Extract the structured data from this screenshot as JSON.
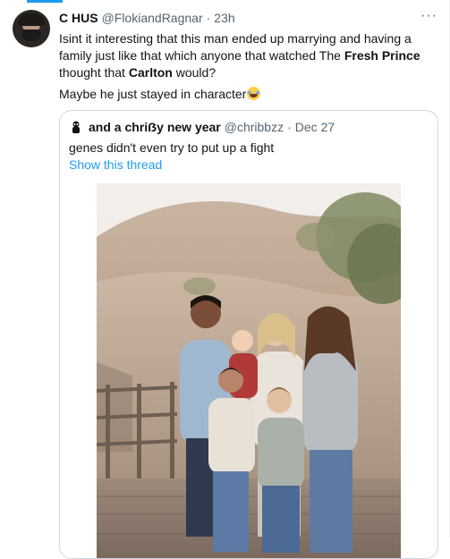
{
  "tweet": {
    "author_name": "C HUS",
    "author_handle": "@FlokiandRagnar",
    "separator": "·",
    "time": "23h",
    "more_icon": "ellipsis-icon",
    "text_part1": "Isint it interesting that this man ended up marrying and having a family just like that which anyone that watched The ",
    "text_bold1": "Fresh Prince",
    "text_part2": " thought that ",
    "text_bold2": "Carlton",
    "text_part3": " would?",
    "text_line2": "Maybe he just stayed in character",
    "emoji": "face-with-tears-of-joy"
  },
  "quoted_tweet": {
    "author_name": "and a chriẞy new year",
    "author_handle": "@chribbzz",
    "separator": "·",
    "date": "Dec 27",
    "text": "genes didn't even try to put up a fight",
    "show_thread_label": "Show this thread",
    "photo": "family-photo"
  },
  "colors": {
    "accent": "#1d9bf0",
    "text": "#0f1419",
    "secondary": "#536471",
    "border": "#cfd9de"
  }
}
